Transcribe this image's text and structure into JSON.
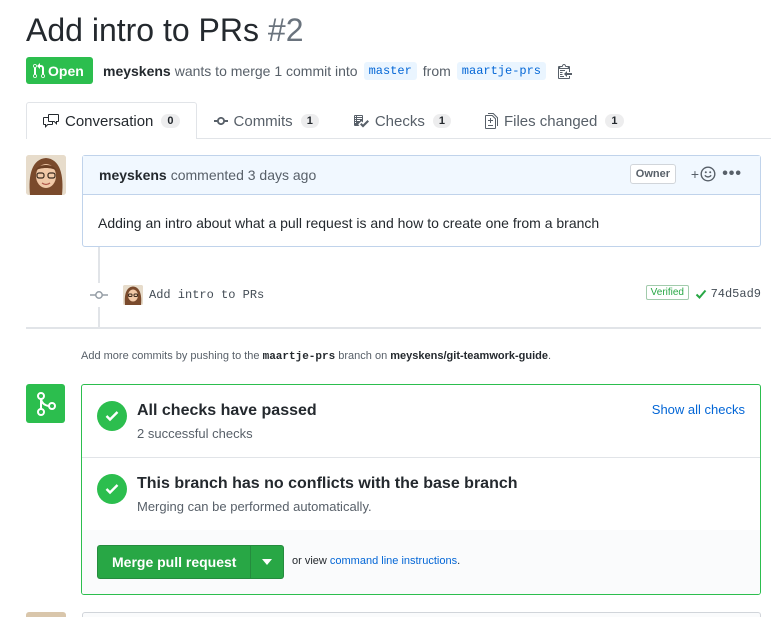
{
  "pr": {
    "title": "Add intro to PRs",
    "number": "#2",
    "state": "Open",
    "author": "meyskens",
    "summary": "wants to merge 1 commit into",
    "base_branch": "master",
    "from_word": "from",
    "head_branch": "maartje-prs"
  },
  "tabs": [
    {
      "label": "Conversation",
      "count": "0",
      "icon": "comment-icon"
    },
    {
      "label": "Commits",
      "count": "1",
      "icon": "commit-icon"
    },
    {
      "label": "Checks",
      "count": "1",
      "icon": "checklist-icon"
    },
    {
      "label": "Files changed",
      "count": "1",
      "icon": "file-diff-icon"
    }
  ],
  "comment": {
    "author": "meyskens",
    "action": "commented 3 days ago",
    "badge": "Owner",
    "react_plus": "+",
    "body": "Adding an intro about what a pull request is and how to create one from a branch"
  },
  "commit": {
    "message": "Add intro to PRs",
    "verified": "Verified",
    "sha": "74d5ad9"
  },
  "hint": {
    "prefix": "Add more commits by pushing to the",
    "branch": "maartje-prs",
    "middle": "branch on",
    "repo": "meyskens/git-teamwork-guide",
    "suffix": "."
  },
  "merge": {
    "checks_title": "All checks have passed",
    "checks_sub": "2 successful checks",
    "show_all": "Show all checks",
    "conflicts_title": "This branch has no conflicts with the base branch",
    "conflicts_sub": "Merging can be performed automatically.",
    "button": "Merge pull request",
    "or_view": "or view",
    "cli_link": "command line instructions",
    "suffix": "."
  },
  "colors": {
    "green": "#2cbe4e",
    "button_green": "#28a745",
    "link_blue": "#0366d6",
    "comment_header": "#f1f8ff"
  }
}
